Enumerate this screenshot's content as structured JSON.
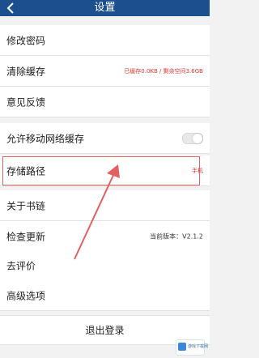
{
  "header": {
    "title": "设置"
  },
  "rows": {
    "change_password": {
      "label": "修改密码"
    },
    "clear_cache": {
      "label": "清除缓存",
      "value": "已缓存0.0KB / 剩余空间3.6GB"
    },
    "feedback": {
      "label": "意见反馈"
    },
    "mobile_cache": {
      "label": "允许移动网络缓存",
      "toggle_on": false
    },
    "storage_path": {
      "label": "存储路径",
      "value": "手机"
    },
    "about": {
      "label": "关于书链"
    },
    "check_update": {
      "label": "检查更新",
      "value": "当前版本：V2.1.2"
    },
    "rate": {
      "label": "去评价"
    },
    "advanced": {
      "label": "高级选项"
    }
  },
  "logout": {
    "label": "退出登录"
  },
  "watermark": {
    "text": "游戏下载网"
  },
  "colors": {
    "header_bg": "#1c4f8e",
    "value_red": "#e0392d",
    "annotation_red": "#e36060"
  },
  "icons": {
    "back": "chevron-left-icon",
    "annotation": "arrow-annotation"
  }
}
